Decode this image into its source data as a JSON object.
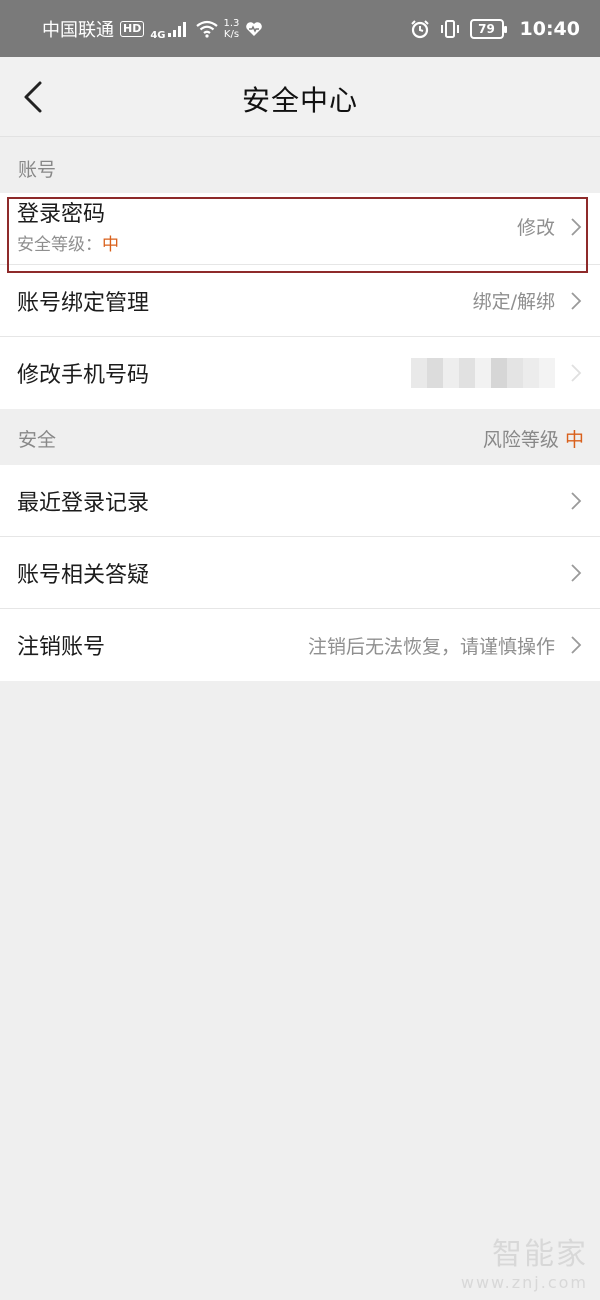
{
  "status_bar": {
    "carrier": "中国联通",
    "hd": "HD",
    "network": "4G",
    "speed_value": "1.3",
    "speed_unit": "K/s",
    "battery": "79",
    "time": "10:40"
  },
  "header": {
    "title": "安全中心"
  },
  "account_section": {
    "label": "账号",
    "items": [
      {
        "title": "登录密码",
        "sub_label": "安全等级：",
        "sub_level": "中",
        "action": "修改"
      },
      {
        "title": "账号绑定管理",
        "action": "绑定/解绑"
      },
      {
        "title": "修改手机号码",
        "action": ""
      }
    ]
  },
  "security_section": {
    "label": "安全",
    "risk_label": "风险等级",
    "risk_level": "中",
    "items": [
      {
        "title": "最近登录记录",
        "action": ""
      },
      {
        "title": "账号相关答疑",
        "action": ""
      },
      {
        "title": "注销账号",
        "action": "注销后无法恢复，请谨慎操作"
      }
    ]
  },
  "watermark": {
    "brand": "智能家",
    "url": "www.znj.com"
  },
  "colors": {
    "accent": "#d9601b",
    "status_bar": "#7a7a7a",
    "highlight": "#8e2a2a"
  }
}
